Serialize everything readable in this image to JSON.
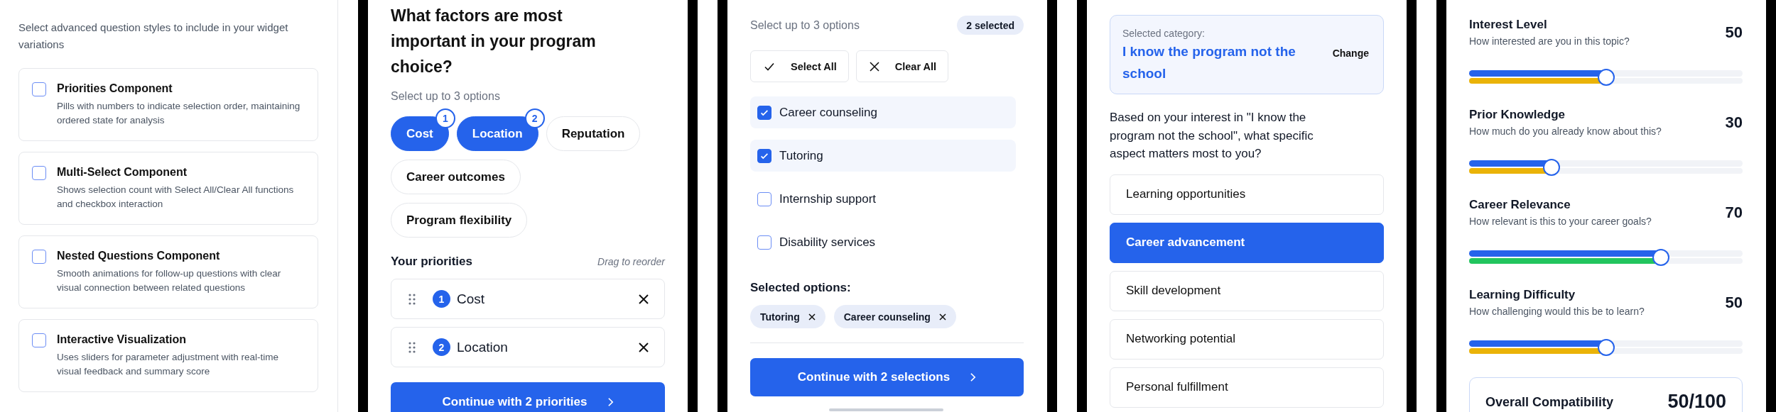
{
  "sidebar": {
    "intro": "Select advanced question styles to include in your widget variations",
    "components": [
      {
        "title": "Priorities Component",
        "description": "Pills with numbers to indicate selection order, maintaining ordered state for analysis",
        "checked": false
      },
      {
        "title": "Multi-Select Component",
        "description": "Shows selection count with Select All/Clear All functions and checkbox interaction",
        "checked": false
      },
      {
        "title": "Nested Questions Component",
        "description": "Smooth animations for follow-up questions with clear visual connection between related questions",
        "checked": false
      },
      {
        "title": "Interactive Visualization",
        "description": "Uses sliders for parameter adjustment with real-time visual feedback and summary score",
        "checked": false
      }
    ]
  },
  "priorities_screen": {
    "question": "What factors are most important in your program choice?",
    "hint": "Select up to 3 options",
    "options": [
      {
        "label": "Cost",
        "selected": true,
        "order": "1"
      },
      {
        "label": "Location",
        "selected": true,
        "order": "2"
      },
      {
        "label": "Reputation",
        "selected": false
      },
      {
        "label": "Career outcomes",
        "selected": false
      },
      {
        "label": "Program flexibility",
        "selected": false
      }
    ],
    "priorities_title": "Your priorities",
    "drag_hint": "Drag to reorder",
    "priorities": [
      {
        "order": "1",
        "label": "Cost"
      },
      {
        "order": "2",
        "label": "Location"
      }
    ],
    "continue_button": "Continue with 2 priorities"
  },
  "multiselect_screen": {
    "hint": "Select up to 3 options",
    "count_badge": "2 selected",
    "select_all": "Select All",
    "clear_all": "Clear All",
    "options": [
      {
        "label": "Career counseling",
        "checked": true
      },
      {
        "label": "Tutoring",
        "checked": true
      },
      {
        "label": "Internship support",
        "checked": false
      },
      {
        "label": "Disability services",
        "checked": false
      }
    ],
    "selected_title": "Selected options:",
    "chips": [
      "Tutoring",
      "Career counseling"
    ],
    "continue_button": "Continue with 2 selections"
  },
  "nested_screen": {
    "category_label": "Selected category:",
    "category": "I know the program not the school",
    "change": "Change",
    "question": "Based on your interest in \"I know the program not the school\", what specific aspect matters most to you?",
    "options": [
      {
        "label": "Learning opportunities",
        "selected": false
      },
      {
        "label": "Career advancement",
        "selected": true
      },
      {
        "label": "Skill development",
        "selected": false
      },
      {
        "label": "Networking potential",
        "selected": false
      },
      {
        "label": "Personal fulfillment",
        "selected": false
      }
    ]
  },
  "sliders_screen": {
    "sliders": [
      {
        "title": "Interest Level",
        "question": "How interested are you in this topic?",
        "value": "50",
        "level": 0.5,
        "color": "#eab308"
      },
      {
        "title": "Prior Knowledge",
        "question": "How much do you already know about this?",
        "value": "30",
        "level": 0.3,
        "color": "#eab308"
      },
      {
        "title": "Career Relevance",
        "question": "How relevant is this to your career goals?",
        "value": "70",
        "level": 0.7,
        "color": "#22c55e"
      },
      {
        "title": "Learning Difficulty",
        "question": "How challenging would this be to learn?",
        "value": "50",
        "level": 0.5,
        "color": "#eab308"
      }
    ],
    "summary": {
      "label": "Overall Compatibility",
      "score": "50/100"
    }
  }
}
